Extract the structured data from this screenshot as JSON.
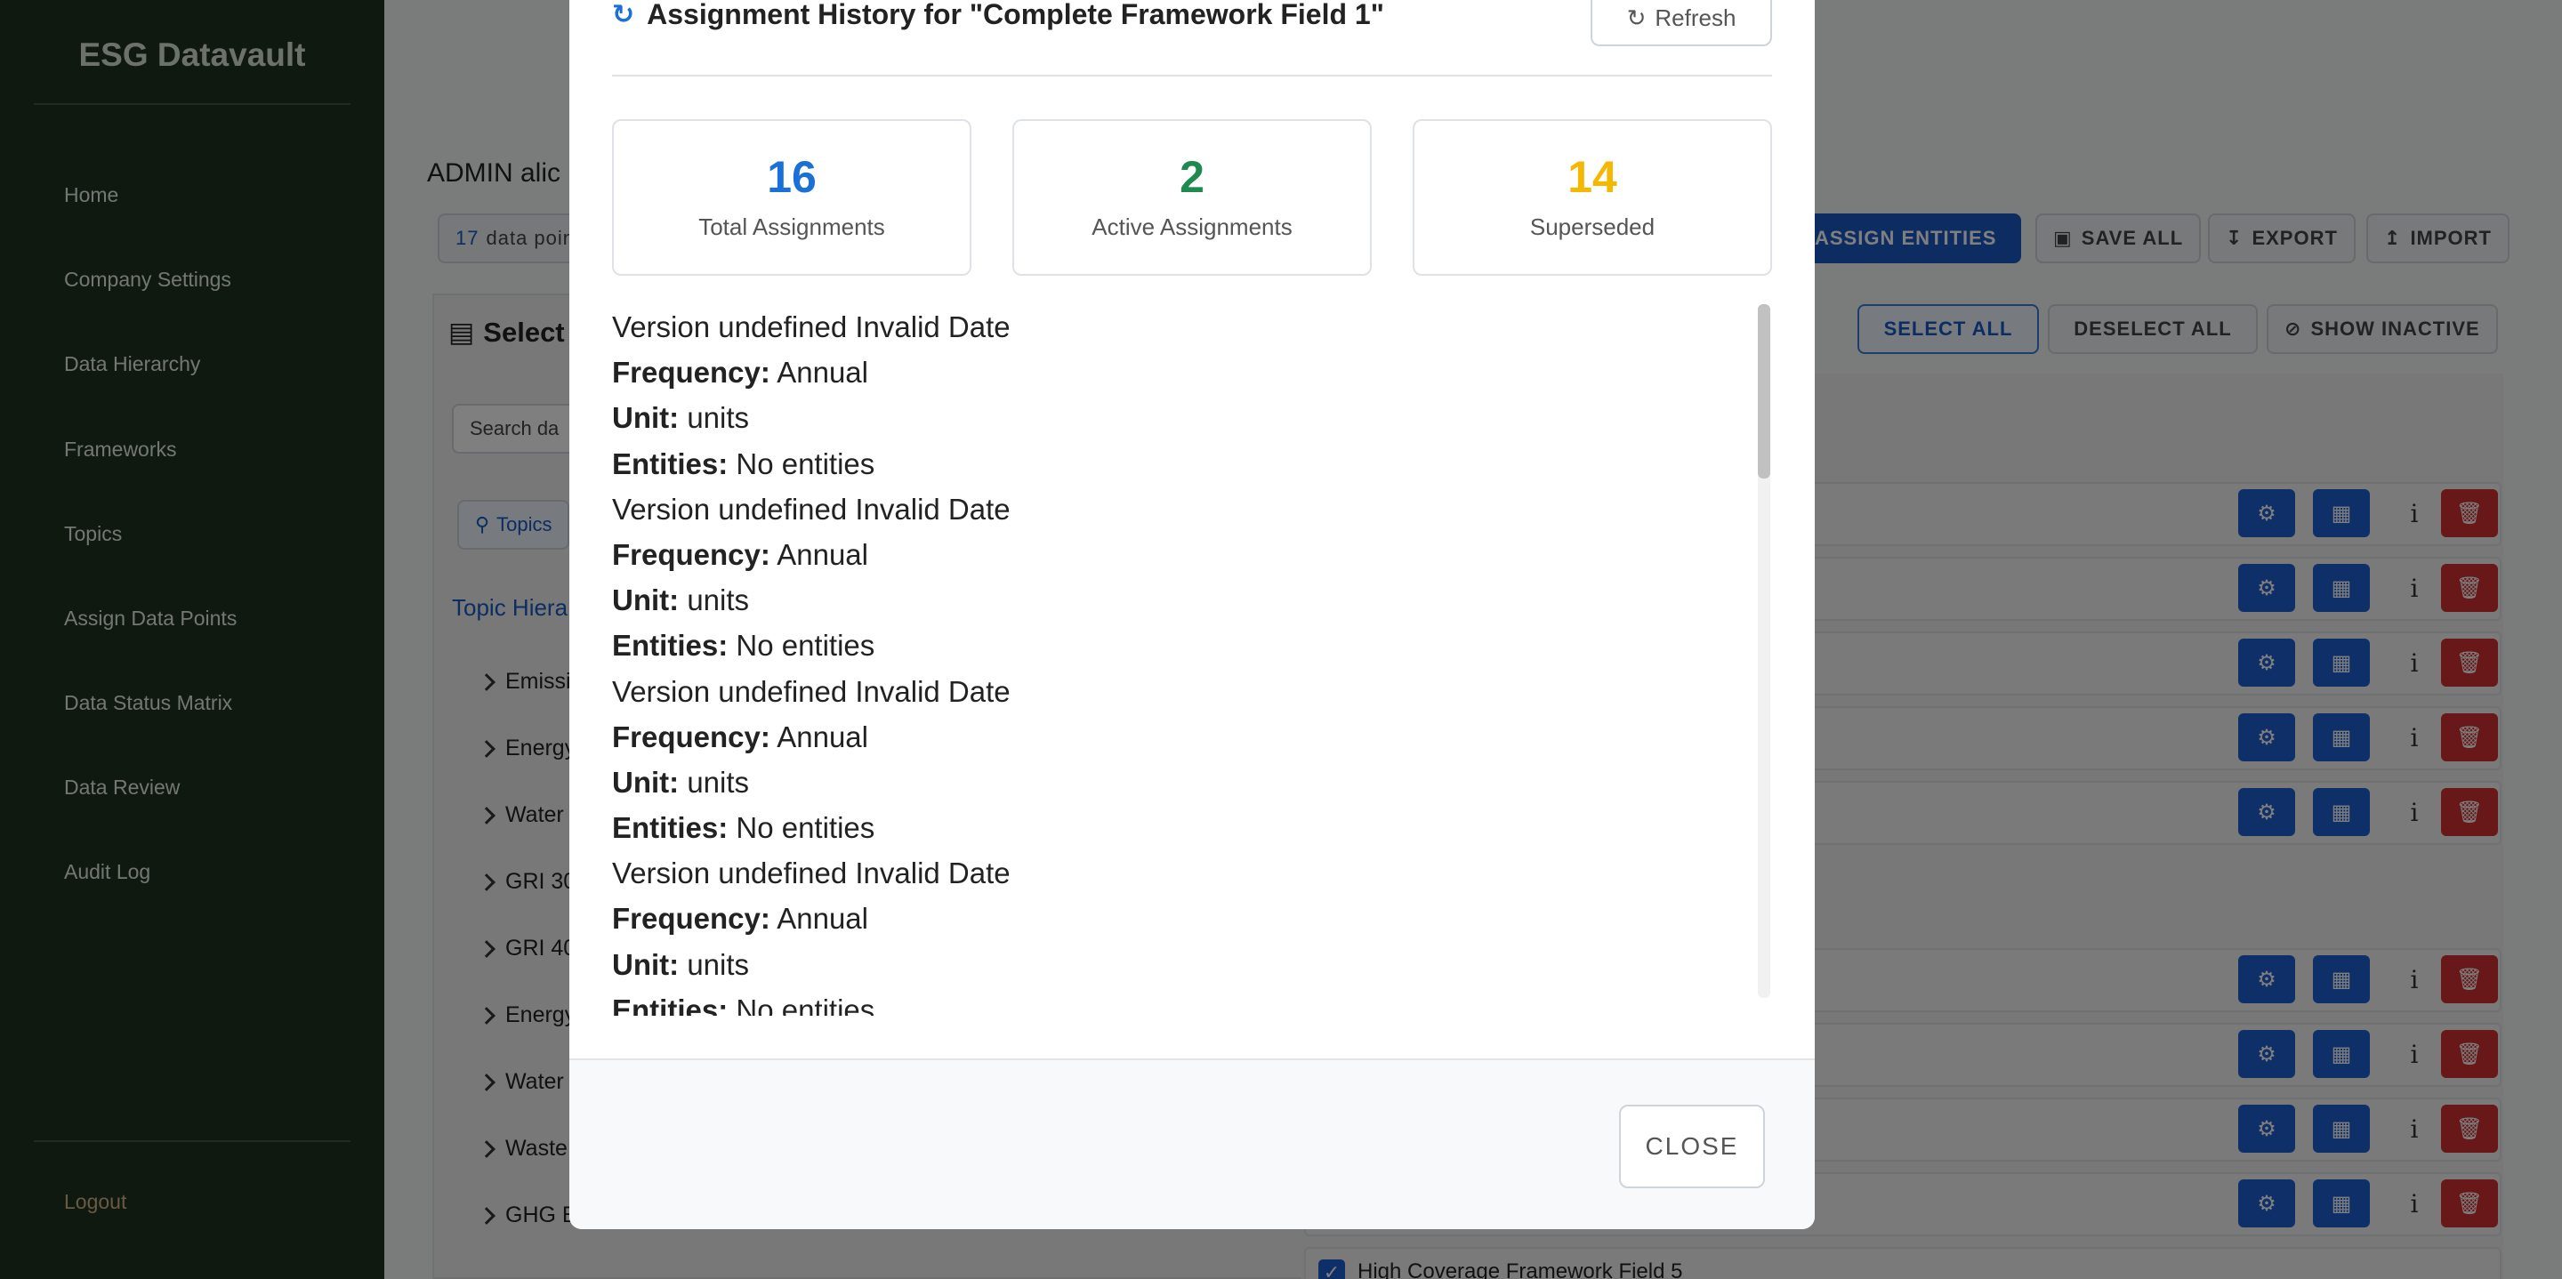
{
  "sidebar": {
    "brand": "ESG Datavault",
    "items": [
      {
        "label": "Home"
      },
      {
        "label": "Company Settings"
      },
      {
        "label": "Data Hierarchy"
      },
      {
        "label": "Frameworks"
      },
      {
        "label": "Topics"
      },
      {
        "label": "Assign Data Points"
      },
      {
        "label": "Data Status Matrix"
      },
      {
        "label": "Data Review"
      },
      {
        "label": "Audit Log"
      }
    ],
    "logout": "Logout"
  },
  "background": {
    "admin_label": "ADMIN alic",
    "count_number": "17",
    "count_text": "data poin",
    "select_header": "Select",
    "search_placeholder": "Search da",
    "topics_tab": "Topics",
    "topic_hierarchy": "Topic Hiera",
    "tree": [
      "Emissi",
      "Energy",
      "Water",
      "GRI 30",
      "GRI 40",
      "Energy",
      "Water",
      "Waste",
      "GHG E"
    ],
    "toolbar": {
      "assign": "ASSIGN ENTITIES",
      "save": "SAVE ALL",
      "export": "EXPORT",
      "import": "IMPORT",
      "select_all": "SELECT ALL",
      "deselect_all": "DESELECT ALL",
      "show_inactive": "SHOW INACTIVE"
    },
    "bottom_item": "High Coverage Framework Field 5",
    "info_glyph": "i"
  },
  "modal": {
    "title": "Assignment History for \"Complete Framework Field 1\"",
    "refresh": "Refresh",
    "stats": [
      {
        "value": "16",
        "label": "Total Assignments",
        "color": "#1a6fd8"
      },
      {
        "value": "2",
        "label": "Active Assignments",
        "color": "#1e8a4f"
      },
      {
        "value": "14",
        "label": "Superseded",
        "color": "#f5b800"
      }
    ],
    "history": [
      {
        "version": "Version undefined Invalid Date",
        "frequency_label": "Frequency:",
        "frequency": "Annual",
        "unit_label": "Unit:",
        "unit": "units",
        "entities_label": "Entities:",
        "entities": "No entities"
      },
      {
        "version": "Version undefined Invalid Date",
        "frequency_label": "Frequency:",
        "frequency": "Annual",
        "unit_label": "Unit:",
        "unit": "units",
        "entities_label": "Entities:",
        "entities": "No entities"
      },
      {
        "version": "Version undefined Invalid Date",
        "frequency_label": "Frequency:",
        "frequency": "Annual",
        "unit_label": "Unit:",
        "unit": "units",
        "entities_label": "Entities:",
        "entities": "No entities"
      },
      {
        "version": "Version undefined Invalid Date",
        "frequency_label": "Frequency:",
        "frequency": "Annual",
        "unit_label": "Unit:",
        "unit": "units",
        "entities_label": "Entities:",
        "entities": "No entities"
      }
    ],
    "close": "CLOSE"
  }
}
